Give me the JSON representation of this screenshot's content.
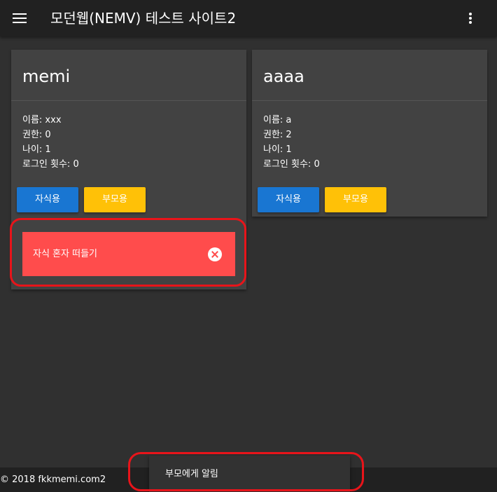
{
  "header": {
    "title": "모던웹(NEMV) 테스트 사이트2",
    "menu_icon": "menu-icon",
    "more_icon": "more-vert-icon",
    "background": "#212121"
  },
  "cards": [
    {
      "title": "memi",
      "info": [
        "이름: xxx",
        "권한: 0",
        "나이: 1",
        "로그인 횟수: 0"
      ],
      "child_button": "자식용",
      "parent_button": "부모용",
      "alert": {
        "text": "자식 혼자 떠들기",
        "close_icon": "close-circle-icon",
        "color": "#ff4c4c"
      }
    },
    {
      "title": "aaaa",
      "info": [
        "이름: a",
        "권한: 2",
        "나이: 1",
        "로그인 횟수: 0"
      ],
      "child_button": "자식용",
      "parent_button": "부모용"
    }
  ],
  "colors": {
    "background": "#303030",
    "card": "#424242",
    "primary_button": "#1976d2",
    "accent_button": "#ffc107",
    "highlight": "#e8141a"
  },
  "footer": {
    "text": "© 2018 fkkmemi.com2"
  },
  "snackbar": {
    "text": "부모에게 알림"
  }
}
